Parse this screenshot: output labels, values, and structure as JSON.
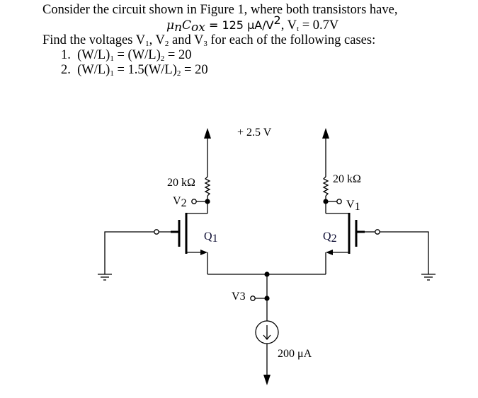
{
  "problem": {
    "intro": "Consider the circuit shown in Figure 1, where both transistors have,",
    "params": {
      "mu_cox_lhs": "μ",
      "mu_sub": "n",
      "cox": "C",
      "cox_sub": "ox",
      "mu_cox_rhs": " = 125 μA/V",
      "mu_cox_exp": "2",
      "vt_label": ", V",
      "vt_sub": "t",
      "vt_value": " = 0.7V"
    },
    "task": {
      "pre": "Find the voltages V",
      "s1": "1",
      "mid1": ", V",
      "s2": "2",
      "mid2": " and V",
      "s3": "3",
      "post": " for each of the following cases:"
    },
    "cases": [
      {
        "num": "1.",
        "a": "(W/L)",
        "as": "1",
        "b": " = (W/L)",
        "bs": "2",
        "c": " = 20"
      },
      {
        "num": "2.",
        "a": "(W/L)",
        "as": "1",
        "b": " = 1.5(W/L)",
        "bs": "2",
        "c": " = 20"
      }
    ]
  },
  "circuit": {
    "supply_label": "+ 2.5 V",
    "r_left_label": "20 kΩ",
    "r_right_label": "20 kΩ",
    "v1": {
      "main": "V",
      "sub": "1"
    },
    "v2": {
      "main": "V",
      "sub": "2"
    },
    "v3": {
      "main": "V",
      "sub": "3"
    },
    "q1": {
      "main": "Q",
      "sub": "1"
    },
    "q2": {
      "main": "Q",
      "sub": "2"
    },
    "current_label": "200 μA"
  }
}
